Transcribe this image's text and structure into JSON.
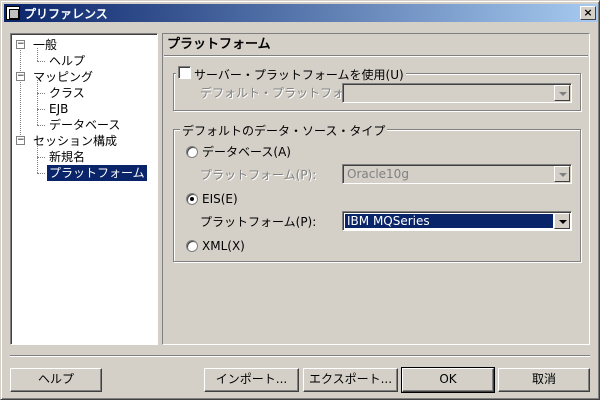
{
  "window": {
    "title": "プリファレンス",
    "close_label": "×"
  },
  "tree": {
    "items": [
      {
        "label": "一般"
      },
      {
        "label": "ヘルプ"
      },
      {
        "label": "マッピング"
      },
      {
        "label": "クラス"
      },
      {
        "label": "EJB"
      },
      {
        "label": "データベース"
      },
      {
        "label": "セッション構成"
      },
      {
        "label": "新規名"
      },
      {
        "label": "プラットフォーム",
        "selected": true
      }
    ],
    "expander_symbol": "−"
  },
  "panel": {
    "title": "プラットフォーム",
    "server_group": {
      "checkbox_label": "サーバー・プラットフォームを使用(U)",
      "checked": false,
      "default_platform_label": "デフォルト・プラットフォーム(D):",
      "default_platform_value": ""
    },
    "datasource_group": {
      "title": "デフォルトのデータ・ソース・タイプ",
      "database_radio_label": "データベース(A)",
      "database_platform_label": "プラットフォーム(P):",
      "database_platform_value": "Oracle10g",
      "eis_radio_label": "EIS(E)",
      "eis_platform_label": "プラットフォーム(P):",
      "eis_platform_value": "IBM MQSeries",
      "xml_radio_label": "XML(X)",
      "selected": "EIS"
    }
  },
  "buttons": {
    "help": "ヘルプ",
    "import": "インポート...",
    "export": "エクスポート...",
    "ok": "OK",
    "cancel": "取消"
  },
  "colors": {
    "titlebar_start": "#0a246a",
    "titlebar_end": "#a6caf0",
    "selection": "#0a246a",
    "face": "#d4d0c8"
  }
}
